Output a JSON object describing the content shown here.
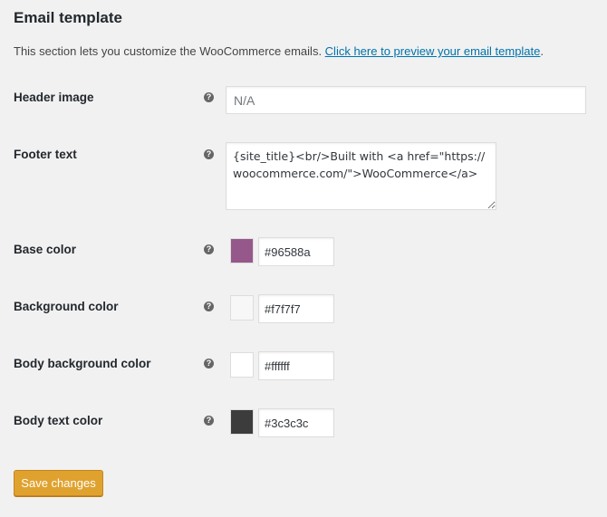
{
  "section": {
    "title": "Email template",
    "intro_text": "This section lets you customize the WooCommerce emails. ",
    "intro_link": "Click here to preview your email template",
    "intro_suffix": "."
  },
  "help_glyph": "?",
  "fields": {
    "header_image": {
      "label": "Header image",
      "placeholder": "N/A",
      "value": ""
    },
    "footer_text": {
      "label": "Footer text",
      "value": "{site_title}<br/>Built with <a href=\"https://woocommerce.com/\">WooCommerce</a>"
    },
    "base_color": {
      "label": "Base color",
      "value": "#96588a",
      "swatch": "#96588a"
    },
    "background_color": {
      "label": "Background color",
      "value": "#f7f7f7",
      "swatch": "#f7f7f7"
    },
    "body_background_color": {
      "label": "Body background color",
      "value": "#ffffff",
      "swatch": "#ffffff"
    },
    "body_text_color": {
      "label": "Body text color",
      "value": "#3c3c3c",
      "swatch": "#3c3c3c"
    }
  },
  "save_button": {
    "label": "Save changes",
    "color": "#e0a22e"
  }
}
